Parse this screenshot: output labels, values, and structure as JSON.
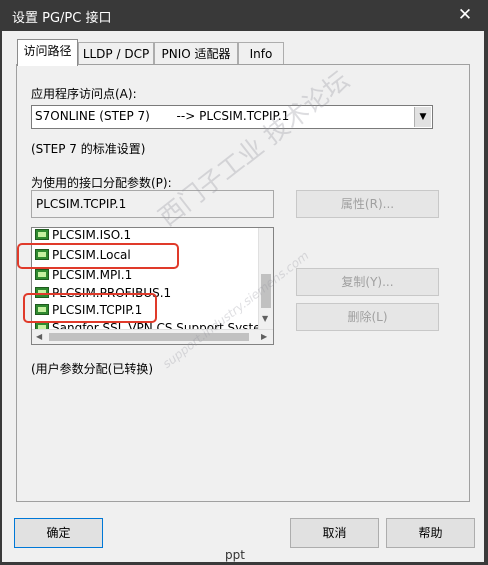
{
  "window": {
    "title": "设置 PG/PC 接口",
    "close_glyph": "✕"
  },
  "tabs": [
    "访问路径",
    "LLDP / DCP",
    "PNIO 适配器",
    "Info"
  ],
  "access_point": {
    "label": "应用程序访问点(A):",
    "value": "S7ONLINE (STEP 7)       --> PLCSIM.TCPIP.1",
    "note": "(STEP 7 的标准设置)"
  },
  "interface": {
    "label": "为使用的接口分配参数(P):",
    "value": "PLCSIM.TCPIP.1",
    "items": [
      "PLCSIM.ISO.1",
      "PLCSIM.Local",
      "PLCSIM.MPI.1",
      "PLCSIM.PROFIBUS.1",
      "PLCSIM.TCPIP.1",
      "Sangfor SSL VPN CS Support Syste"
    ],
    "icon": "network-adapter-icon"
  },
  "buttons": {
    "properties": "属性(R)...",
    "copy": "复制(Y)...",
    "delete": "删除(L)"
  },
  "status_note": "(用户参数分配(已转换)",
  "footer": {
    "ok": "确定",
    "cancel": "取消",
    "help": "帮助"
  },
  "watermark": {
    "main": "西门子工业  技术论坛",
    "sub": "support.industry.siemens.com"
  },
  "bottom_text": "ppt",
  "colors": {
    "highlight": "#e03a2a",
    "titlebar": "#393939",
    "icon_green": "#2f8a2f"
  }
}
